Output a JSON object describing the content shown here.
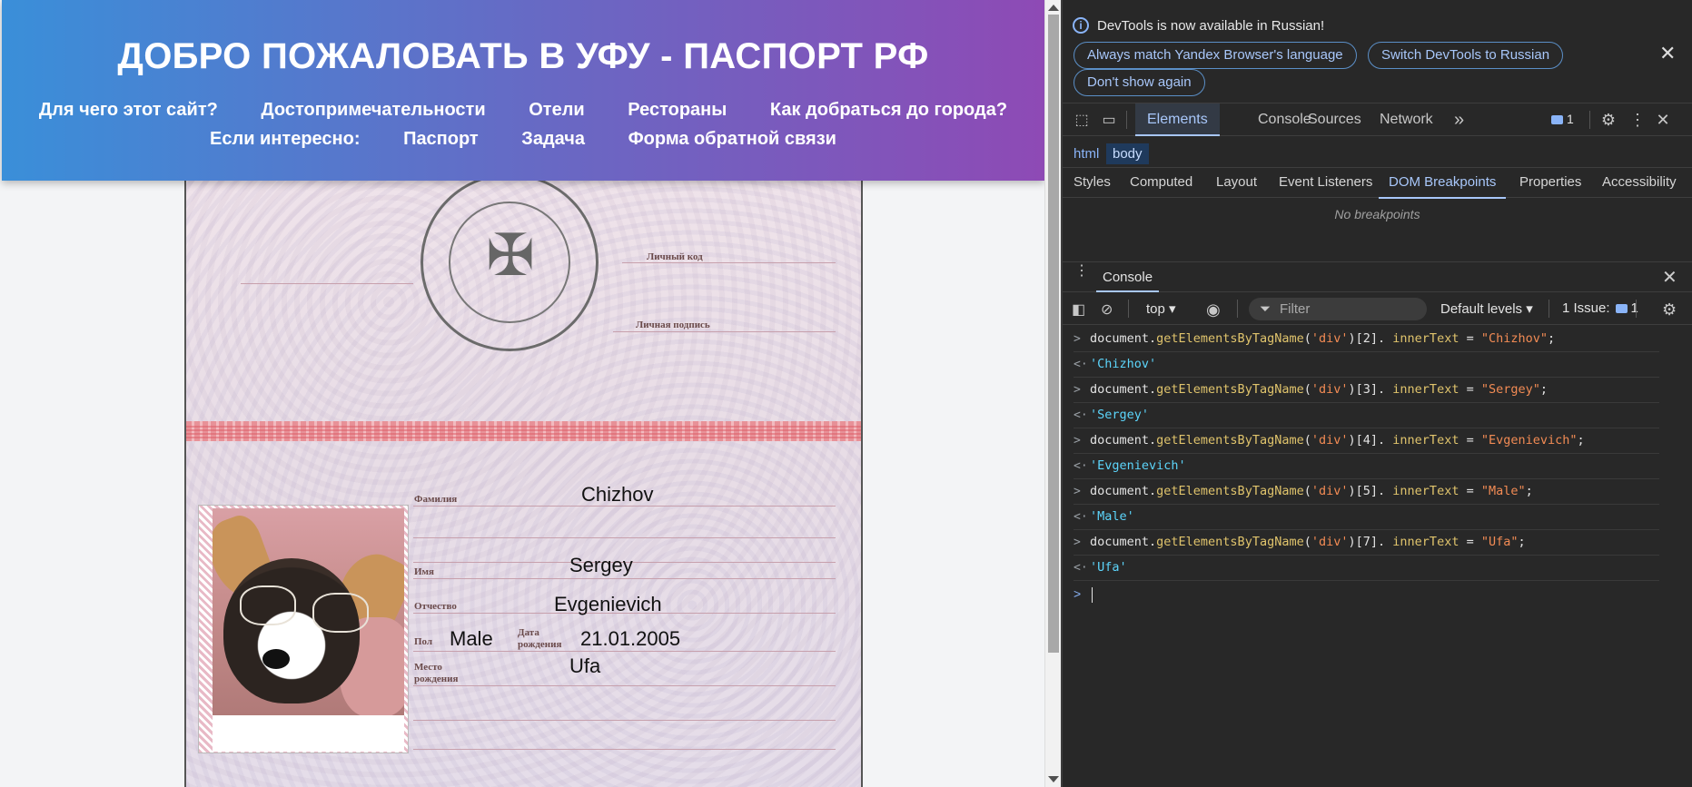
{
  "site": {
    "title": "ДОБРО ПОЖАЛОВАТЬ В УФУ - ПАСПОРТ РФ",
    "nav_row1": [
      "Для чего этот сайт?",
      "Достопримечательности",
      "Отели",
      "Рестораны",
      "Как добраться до города?"
    ],
    "nav_row2": [
      "Если интересно:",
      "Паспорт",
      "Задача",
      "Форма обратной связи"
    ]
  },
  "passport": {
    "surname": "Chizhov",
    "name": "Sergey",
    "patronymic": "Evgenievich",
    "gender": "Male",
    "birth_date": "21.01.2005",
    "birth_place": "Ufa",
    "labels": {
      "personal_code": "Личный код",
      "signature": "Личная подпись",
      "surname": "Фамилия",
      "name": "Имя",
      "patronymic": "Отчество",
      "gender": "Пол",
      "birth_date_1": "Дата",
      "birth_date_2": "рождения",
      "birth_place_1": "Место",
      "birth_place_2": "рождения"
    }
  },
  "devtools": {
    "infobar": {
      "message": "DevTools is now available in Russian!",
      "btn_match": "Always match Yandex Browser's language",
      "btn_switch": "Switch DevTools to Russian",
      "btn_dont_show": "Don't show again"
    },
    "tabs": [
      "Elements",
      "Console",
      "Sources",
      "Network"
    ],
    "more_tabs": "»",
    "issues_count": "1",
    "breadcrumbs": [
      "html",
      "body"
    ],
    "subtabs": [
      "Styles",
      "Computed",
      "Layout",
      "Event Listeners",
      "DOM Breakpoints",
      "Properties",
      "Accessibility"
    ],
    "no_breakpoints": "No breakpoints",
    "drawer_tab": "Console",
    "context": "top",
    "filter_placeholder": "Filter",
    "levels": "Default levels",
    "issue_label": "1 Issue:",
    "issue_count": "1",
    "console_entries": [
      {
        "index": "2",
        "value": "\"Chizhov\"",
        "result": "'Chizhov'"
      },
      {
        "index": "3",
        "value": "\"Sergey\"",
        "result": "'Sergey'"
      },
      {
        "index": "4",
        "value": "\"Evgenievich\"",
        "result": "'Evgenievich'"
      },
      {
        "index": "5",
        "value": "\"Male\"",
        "result": "'Male'"
      },
      {
        "index": "7",
        "value": "\"Ufa\"",
        "result": "'Ufa'"
      }
    ],
    "code_parts": {
      "obj": "document.",
      "fn": "getElementsByTagName",
      "open": "(",
      "arg": "'div'",
      "close": ")[",
      "close2": "]. ",
      "prop": "innerText",
      "assign": " = ",
      "end": ";"
    }
  }
}
